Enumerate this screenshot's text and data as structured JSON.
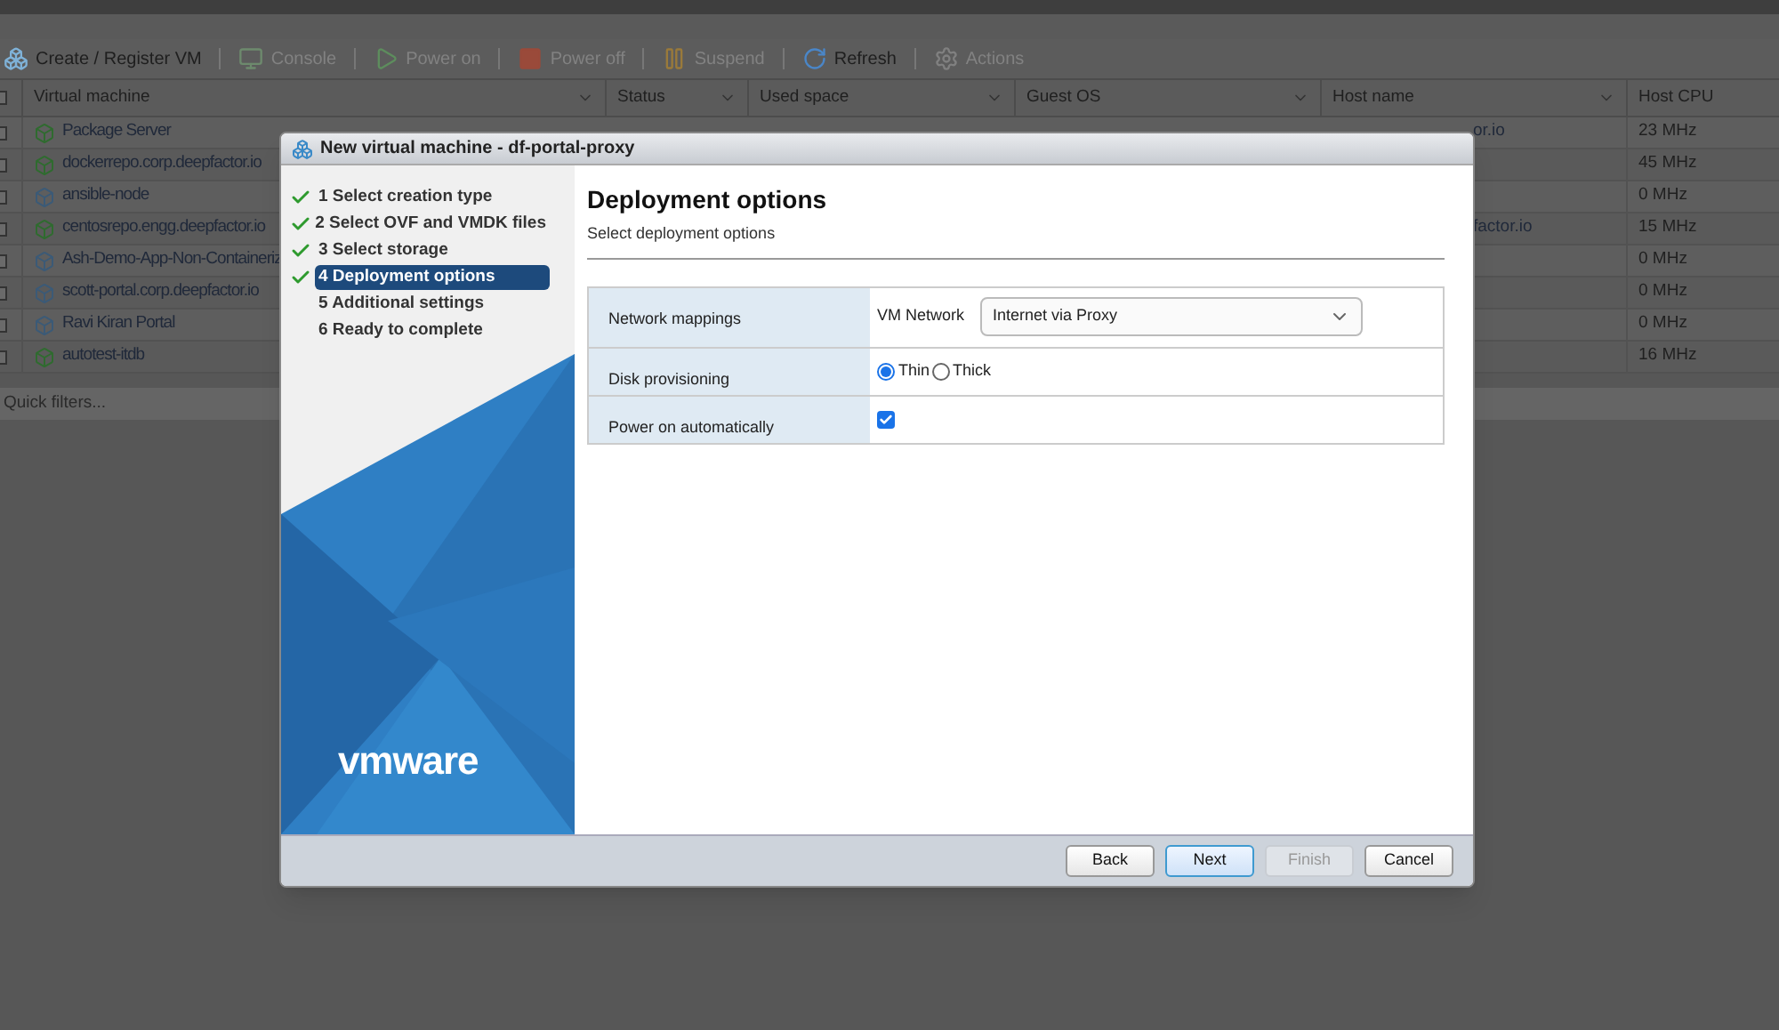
{
  "toolbar": [
    {
      "label": "Create / Register VM",
      "kind": "create",
      "disabled": false
    },
    {
      "label": "Console",
      "kind": "console",
      "disabled": true
    },
    {
      "label": "Power on",
      "kind": "poweron",
      "disabled": true
    },
    {
      "label": "Power off",
      "kind": "poweroff",
      "disabled": true
    },
    {
      "label": "Suspend",
      "kind": "suspend",
      "disabled": true
    },
    {
      "label": "Refresh",
      "kind": "refresh",
      "disabled": false
    },
    {
      "label": "Actions",
      "kind": "actions",
      "disabled": true
    }
  ],
  "table": {
    "select_all_checked": false,
    "columns": [
      "Virtual machine",
      "Status",
      "Used space",
      "Guest OS",
      "Host name",
      "Host CPU"
    ],
    "rows": [
      {
        "name": "Package Server",
        "checked": false,
        "powered_on": true,
        "host_name": "or.io",
        "host_cpu": "23 MHz"
      },
      {
        "name": "dockerrepo.corp.deepfactor.io",
        "checked": false,
        "powered_on": true,
        "host_cpu": "45 MHz"
      },
      {
        "name": "ansible-node",
        "checked": false,
        "powered_on": false,
        "host_cpu": "0 MHz"
      },
      {
        "name": "centosrepo.engg.deepfactor.io",
        "checked": false,
        "powered_on": true,
        "host_name": "factor.io",
        "host_cpu": "15 MHz"
      },
      {
        "name": "Ash-Demo-App-Non-Containeriz",
        "checked": false,
        "powered_on": false,
        "host_cpu": "0 MHz"
      },
      {
        "name": "scott-portal.corp.deepfactor.io",
        "checked": false,
        "powered_on": false,
        "host_cpu": "0 MHz"
      },
      {
        "name": "Ravi Kiran Portal",
        "checked": false,
        "powered_on": false,
        "host_cpu": "0 MHz"
      },
      {
        "name": "autotest-itdb",
        "checked": false,
        "powered_on": true,
        "host_cpu": "16 MHz"
      }
    ]
  },
  "quick_filters": "Quick filters...",
  "dialog": {
    "title": "New virtual machine - df-portal-proxy",
    "steps": [
      {
        "label": "1 Select creation type",
        "done": true,
        "selected": false
      },
      {
        "label": "2 Select OVF and VMDK files",
        "done": true,
        "selected": false
      },
      {
        "label": "3 Select storage",
        "done": true,
        "selected": false
      },
      {
        "label": "4 Deployment options",
        "done": true,
        "selected": true
      },
      {
        "label": "5 Additional settings",
        "done": false,
        "selected": false
      },
      {
        "label": "6 Ready to complete",
        "done": false,
        "selected": false
      }
    ],
    "logo": "vmware",
    "heading": "Deployment options",
    "subheading": "Select deployment options",
    "options": [
      {
        "kind": "network",
        "label": "Network mappings",
        "field_label": "VM Network",
        "value": "Internet via Proxy"
      },
      {
        "kind": "radio",
        "label": "Disk provisioning",
        "choices": [
          {
            "label": "Thin",
            "selected": true
          },
          {
            "label": "Thick",
            "selected": false
          }
        ]
      },
      {
        "kind": "checkbox",
        "label": "Power on automatically",
        "checked": true
      }
    ],
    "buttons": [
      {
        "label": "Back",
        "primary": false,
        "disabled": false
      },
      {
        "label": "Next",
        "primary": true,
        "disabled": false
      },
      {
        "label": "Finish",
        "primary": false,
        "disabled": true
      },
      {
        "label": "Cancel",
        "primary": false,
        "disabled": false
      }
    ]
  }
}
